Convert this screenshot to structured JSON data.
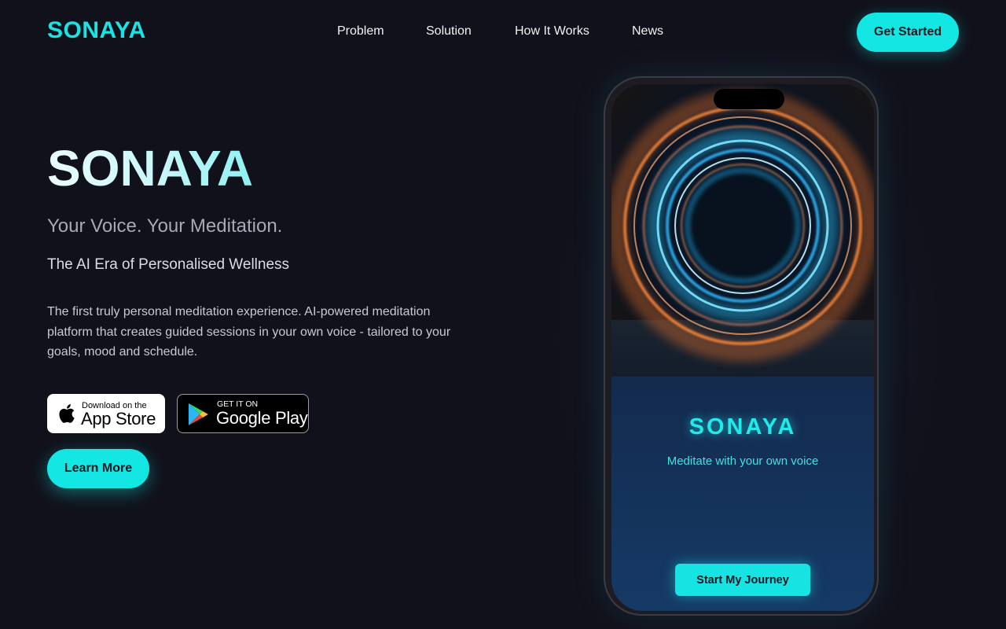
{
  "nav": {
    "logo": "SONAYA",
    "links": [
      "Problem",
      "Solution",
      "How It Works",
      "News"
    ],
    "cta_label": "Get Started"
  },
  "hero": {
    "title": "SONAYA",
    "tagline": "Your Voice. Your Meditation.",
    "subtitle": "The AI Era of Personalised Wellness",
    "description": "The first truly personal meditation experience. AI-powered meditation platform that creates guided sessions in your own voice - tailored to your goals, mood and schedule.",
    "app_store": {
      "small": "Download on the",
      "big": "App Store"
    },
    "google_play": {
      "small": "GET IT ON",
      "big": "Google Play"
    },
    "learn_more_label": "Learn More"
  },
  "phone": {
    "app_name": "SONAYA",
    "app_tagline": "Meditate with your own voice",
    "journey_label": "Start My Journey"
  },
  "colors": {
    "accent": "#14e6e3",
    "background": "#11111b"
  },
  "icons": [
    "apple-icon",
    "google-play-icon"
  ]
}
